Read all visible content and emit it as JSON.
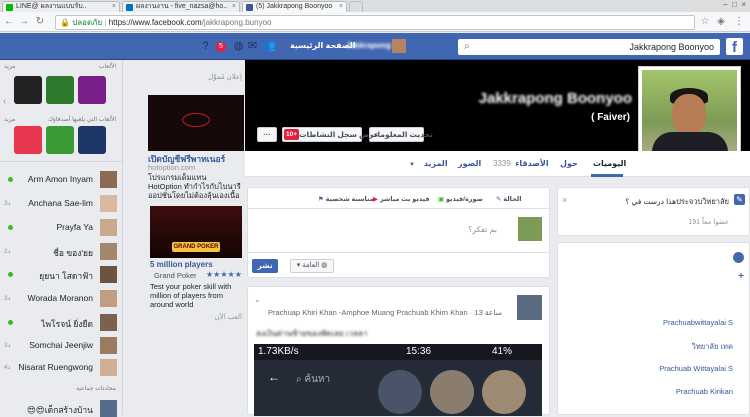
{
  "browser": {
    "tabs": [
      {
        "label": "LINE@ ผลงานแบบรับ..",
        "color": "#00b900"
      },
      {
        "label": "ผลงานงาน - five_nazsa@ho..",
        "color": "#0072c6"
      },
      {
        "label": "(5) Jakkrapong Boonyoo",
        "color": "#3b5998"
      }
    ],
    "secure_label": "ปลอดภัย",
    "url_host": "https://www.facebook.com",
    "url_path": "/jakkrapong.bunyoo"
  },
  "fb_header": {
    "search_value": "Jakkrapong Boonyoo",
    "logo": "f",
    "home_label": "الصفحة الرئيسية",
    "user_label": "Jakkrapong",
    "badge_count": "5"
  },
  "left": {
    "section_games": "الألعاب",
    "section_friends_playing": "الألعاب التي يلعبها أصدقاؤك",
    "contacts": [
      {
        "name": "Arm Amon Inyam",
        "status": "online",
        "time": ""
      },
      {
        "name": "Anchana Sae-lim",
        "status": "time",
        "time": "3د"
      },
      {
        "name": "Prayfa Ya",
        "status": "online",
        "time": ""
      },
      {
        "name": "ชื่อ ของ'ยย",
        "status": "time",
        "time": "2د"
      },
      {
        "name": "ยุยนา โสดาฟ้า",
        "status": "online",
        "time": ""
      },
      {
        "name": "Worada Moranon",
        "status": "time",
        "time": "3د"
      },
      {
        "name": "ไพโรจน์ ยิ่งยืด",
        "status": "online",
        "time": ""
      },
      {
        "name": "Somchai Jeenjiw",
        "status": "time",
        "time": "3د"
      },
      {
        "name": "Nisarat Ruengwong",
        "status": "time",
        "time": "4د"
      }
    ],
    "groups_header": "محادثات جماعية",
    "group_name": "😍😍เด็กสร้างบ้าน"
  },
  "ads": {
    "header": "إعلان مُموَّل",
    "ad1_title": "เปิดบัญชีฟรีพาทเนอร์",
    "ad1_domain": "hotoption.com",
    "ad1_text": "โปรแกรมเด็มแทน HotOption ทำกำไรกับไบนารีออปชั่นโดยไม่ต้องลุ้นเองเนื้อ",
    "ad2_title": "5 million players",
    "ad2_sub": "Grand Poker",
    "ad2_text": "Test your poker skill with million of players from around world",
    "ad2_image_label": "GRAND POKER",
    "now_label": "العب الآن"
  },
  "profile": {
    "name": "Jakkrapong Boonyoo",
    "nickname": "( Faiver)",
    "update_info_label": "تحديث المعلومات",
    "activity_log_label": "عرض سجل النشاطات",
    "activity_badge": "10+",
    "more_dots": "···"
  },
  "tabs": {
    "timeline": "اليوميات",
    "about": "حول",
    "friends": "الأصدقاء",
    "friends_count": "3339",
    "photos": "الصور",
    "more": "المزيد"
  },
  "composer": {
    "status_label": "الحالة",
    "photo_label": "صورة/فيديو",
    "live_label": "فيديو بث مباشر",
    "event_label": "مناسبة شخصية",
    "placeholder": "بم تفكر؟",
    "audience_label": "العامة",
    "post_label": "نشر"
  },
  "right": {
    "question_text": "هذا درست في ؟ประจวบวิทยาลัย",
    "question_count": "191 عضوا معاً",
    "list_items": [
      "Prachuabwittayalai S",
      "วิทยาลัย เทค",
      "Prachuab Wittayalai S",
      "Prachuab Kirikan"
    ]
  },
  "post": {
    "location": "Prachuap Khiri Khan -Amphoe Muang Prachuab Khirn Khan",
    "time": "13 ساعة",
    "text": "ลงเงินด่านซ้ายของพัดเลย เวลลา",
    "phone_speed": "1.73KB/s",
    "phone_time": "15:36",
    "phone_battery": "41%",
    "phone_search": "ค้นหา"
  }
}
